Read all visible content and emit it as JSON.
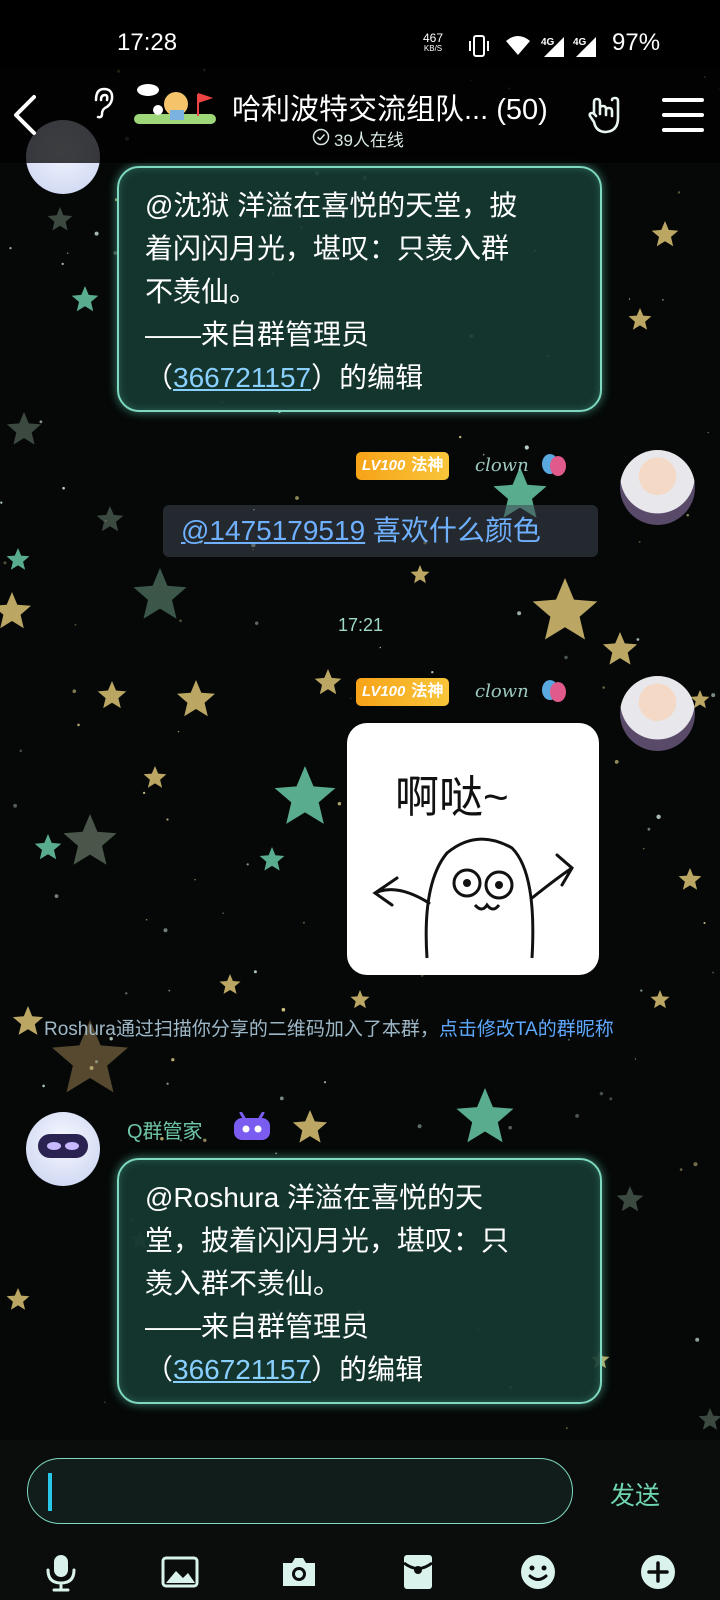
{
  "status_bar": {
    "time": "17:28",
    "net_speed": "467",
    "net_unit": "KB/S",
    "battery": "97%",
    "icons": [
      "vibrate-icon",
      "wifi-icon",
      "signal-4g-icon",
      "signal-4g-icon"
    ]
  },
  "header": {
    "title": "哈利波特交流组队... (50)",
    "online": "39人在线",
    "icons": [
      "back-icon",
      "ear-icon",
      "group-banner",
      "rock-hand-icon",
      "menu-icon"
    ]
  },
  "messages": {
    "m1": {
      "line1": "@沈狱 洋溢在喜悦的天堂，披",
      "line2": "着闪闪月光，堪叹：只羡入群",
      "line3": "不羡仙。",
      "line4": "——来自群管理员",
      "line5_pre": "（",
      "line5_link": "366721157",
      "line5_post": "）的编辑"
    },
    "m2": {
      "level": "LV100",
      "title_badge": "法神",
      "tag": "clown",
      "mention": "@1475179519",
      "text": " 喜欢什么颜色"
    },
    "timestamp": "17:21",
    "m3": {
      "level": "LV100",
      "title_badge": "法神",
      "tag": "clown",
      "sticker_text": "啊哒~"
    },
    "system": {
      "text": "Roshura通过扫描你分享的二维码加入了本群，",
      "action": "点击修改TA的群昵称"
    },
    "m4": {
      "sender": "Q群管家",
      "line1": "@Roshura 洋溢在喜悦的天",
      "line2": "堂，披着闪闪月光，堪叹：只",
      "line3": "羡入群不羡仙。",
      "line4": "——来自群管理员",
      "line5_pre": "（",
      "line5_link": "366721157",
      "line5_post": "）的编辑"
    }
  },
  "input_bar": {
    "value": "",
    "send_label": "发送",
    "tools": [
      "mic-icon",
      "image-icon",
      "camera-icon",
      "red-packet-icon",
      "emoji-icon",
      "plus-icon"
    ]
  },
  "colors": {
    "accent": "#7fd8c0",
    "bubble_bg": "#163a32",
    "link": "#8ad0ff",
    "level_badge": "#f7a318"
  }
}
